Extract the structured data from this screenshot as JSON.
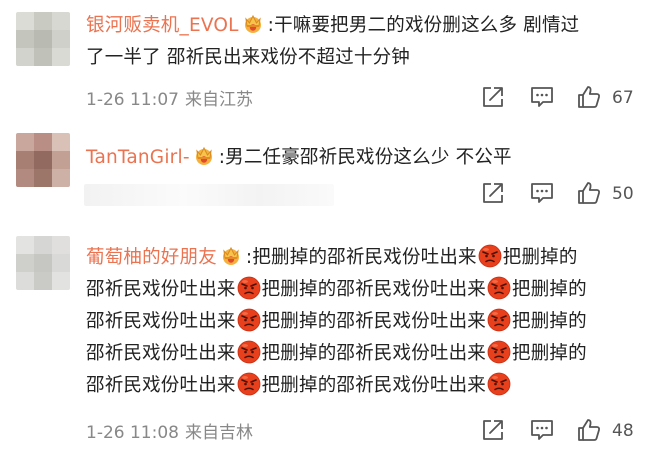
{
  "comments": [
    {
      "username": "银河贩卖机_EVOL",
      "lines": [
        ":干嘛要把男二的戏份删这么多 剧情过",
        "了一半了 邵祈民出来戏份不超过十分钟"
      ],
      "time": "1-26 11:07",
      "location": "来自江苏",
      "likes": "67"
    },
    {
      "username": "TanTanGirl-",
      "lines": [
        ":男二任豪邵祈民戏份这么少 不公平"
      ],
      "time": "",
      "location": "",
      "likes": "50"
    },
    {
      "username": "葡萄柚的好朋友",
      "head": ":把删掉的邵祈民戏份吐出来",
      "tail": "把删掉的",
      "repeat_a": "邵祈民戏份吐出来",
      "repeat_b": "把删掉的邵祈民戏份吐出来",
      "repeat_c": "把删掉的",
      "time": "1-26 11:08",
      "location": "来自吉林",
      "likes": "48"
    }
  ],
  "icons": {
    "member_badge": "crown-badge-icon",
    "emoji": "angry-face-emoji",
    "share": "share-icon",
    "comment": "comment-icon",
    "like": "thumbs-up-icon"
  },
  "colors": {
    "username": "#eb7350",
    "meta": "#888888",
    "emoji": "#e8401c"
  }
}
